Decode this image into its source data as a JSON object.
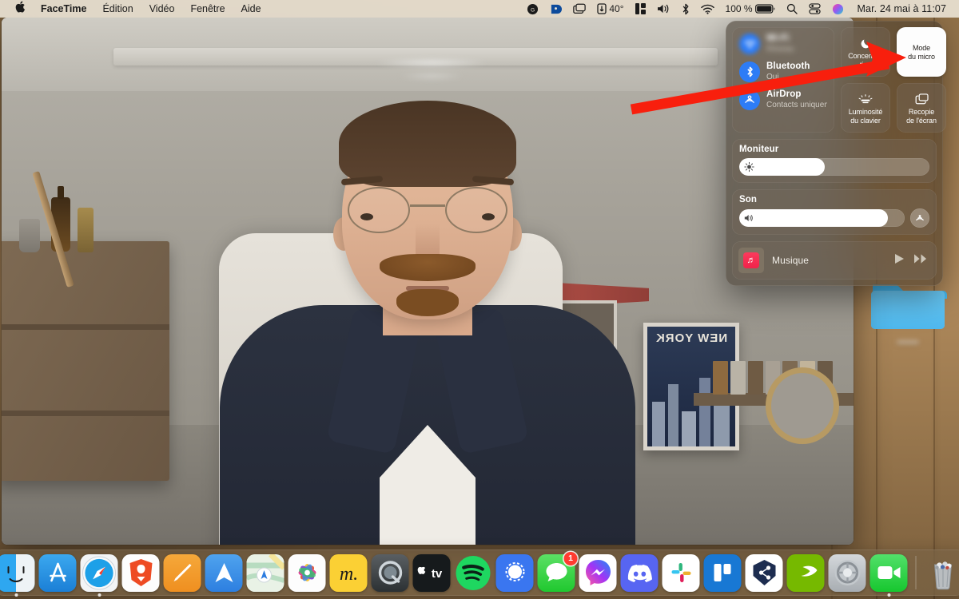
{
  "menubar": {
    "apple_icon": "apple-logo",
    "items": [
      {
        "label": "FaceTime",
        "bold": true
      },
      {
        "label": "Édition",
        "bold": false
      },
      {
        "label": "Vidéo",
        "bold": false
      },
      {
        "label": "Fenêtre",
        "bold": false
      },
      {
        "label": "Aide",
        "bold": false
      }
    ],
    "status_items": [
      {
        "name": "grammarly-icon",
        "label": ""
      },
      {
        "name": "dashlane-icon",
        "label": ""
      },
      {
        "name": "screen-mirroring-icon",
        "label": ""
      },
      {
        "name": "weather-icon",
        "label": "40°"
      },
      {
        "name": "rectangle-window-manager-icon",
        "label": ""
      },
      {
        "name": "volume-icon",
        "label": ""
      },
      {
        "name": "bluetooth-icon",
        "label": ""
      },
      {
        "name": "wifi-icon",
        "label": ""
      },
      {
        "name": "battery-icon",
        "label": "100 %"
      },
      {
        "name": "spotlight-search-icon",
        "label": ""
      },
      {
        "name": "control-center-icon",
        "label": ""
      },
      {
        "name": "siri-icon",
        "label": ""
      }
    ],
    "battery_percent": "100 %",
    "weather_temp": "40°",
    "clock": "Mar. 24 mai à  11:07"
  },
  "control_center": {
    "wifi": {
      "title": "Wi-Fi",
      "subtitle": "Réseau",
      "redacted": true,
      "icon": "wifi-icon"
    },
    "bluetooth": {
      "title": "Bluetooth",
      "subtitle": "Oui",
      "icon": "bluetooth-icon"
    },
    "airdrop": {
      "title": "AirDrop",
      "subtitle": "Contacts uniquement",
      "icon": "airdrop-icon"
    },
    "tiles": [
      {
        "label": "Concentra-\ntion",
        "icon": "moon-icon",
        "active": false,
        "name": "focus-tile"
      },
      {
        "label": "Mode\ndu micro",
        "icon": "none",
        "active": true,
        "name": "mic-mode-tile"
      },
      {
        "label": "Luminosité\ndu clavier",
        "icon": "keyboard-brightness-icon",
        "active": false,
        "name": "keyboard-brightness-tile"
      },
      {
        "label": "Recopie\nde l'écran",
        "icon": "screen-mirroring-icon",
        "active": false,
        "name": "screen-mirroring-tile"
      }
    ],
    "display": {
      "label": "Moniteur",
      "value": 45,
      "icon": "sun-icon"
    },
    "sound": {
      "label": "Son",
      "value": 90,
      "icon": "speaker-icon",
      "airplay_icon": "airplay-icon"
    },
    "music": {
      "app": "Musique",
      "art_icon": "music-note-icon",
      "play_icon": "play-icon",
      "next_icon": "forward-icon"
    }
  },
  "facetime": {
    "window_title_redacted": true,
    "caller_name_redacted": "•••••••• ••••••••"
  },
  "desktop": {
    "folder": {
      "icon": "folder-icon",
      "label_redacted": true,
      "label": "•••••••"
    }
  },
  "annotation": {
    "arrow_color": "#f81f0d",
    "points_at": "mic-mode-tile"
  },
  "dock": {
    "items": [
      {
        "name": "finder",
        "label": "Finder",
        "running": true
      },
      {
        "name": "app-store",
        "label": "App Store",
        "running": false
      },
      {
        "name": "safari",
        "label": "Safari",
        "running": true
      },
      {
        "name": "brave",
        "label": "Brave",
        "running": false
      },
      {
        "name": "notes",
        "label": "Notes",
        "running": false
      },
      {
        "name": "spark-mail",
        "label": "Spark",
        "running": false
      },
      {
        "name": "maps",
        "label": "Plans",
        "running": false
      },
      {
        "name": "photos",
        "label": "Photos",
        "running": false
      },
      {
        "name": "mindnode",
        "label": "MindNode",
        "running": false
      },
      {
        "name": "quicktime",
        "label": "QuickTime Player",
        "running": false
      },
      {
        "name": "apple-tv",
        "label": "Apple TV",
        "running": false
      },
      {
        "name": "spotify",
        "label": "Spotify",
        "running": false
      },
      {
        "name": "signal",
        "label": "Signal",
        "running": false
      },
      {
        "name": "messages",
        "label": "Messages",
        "running": false,
        "badge": "1"
      },
      {
        "name": "messenger",
        "label": "Messenger",
        "running": false
      },
      {
        "name": "discord",
        "label": "Discord",
        "running": false
      },
      {
        "name": "slack",
        "label": "Slack",
        "running": false
      },
      {
        "name": "trello",
        "label": "Trello",
        "running": false
      },
      {
        "name": "sharemouse",
        "label": "ShareMouse",
        "running": false
      },
      {
        "name": "nvidia",
        "label": "NVIDIA",
        "running": false
      },
      {
        "name": "system-preferences",
        "label": "Préférences Système",
        "running": false
      },
      {
        "name": "facetime",
        "label": "FaceTime",
        "running": true
      }
    ],
    "trash": {
      "name": "trash",
      "label": "Corbeille"
    }
  }
}
